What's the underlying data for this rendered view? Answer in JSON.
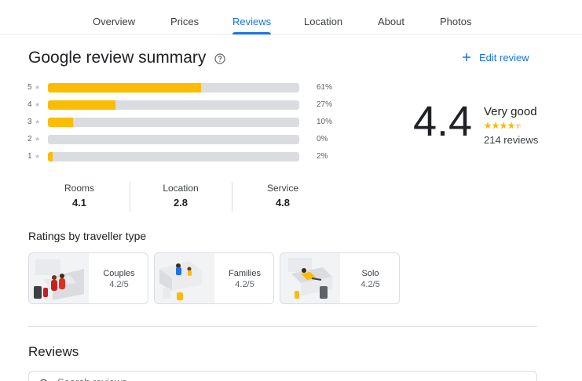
{
  "tabs": [
    {
      "label": "Overview"
    },
    {
      "label": "Prices"
    },
    {
      "label": "Reviews",
      "active": true
    },
    {
      "label": "Location"
    },
    {
      "label": "About"
    },
    {
      "label": "Photos"
    }
  ],
  "summary": {
    "title": "Google review summary",
    "edit_label": "Edit review",
    "histogram": [
      {
        "stars": "5",
        "percent_label": "61%",
        "fraction": 0.61
      },
      {
        "stars": "4",
        "percent_label": "27%",
        "fraction": 0.27
      },
      {
        "stars": "3",
        "percent_label": "10%",
        "fraction": 0.1
      },
      {
        "stars": "2",
        "percent_label": "0%",
        "fraction": 0.0
      },
      {
        "stars": "1",
        "percent_label": "2%",
        "fraction": 0.02
      }
    ],
    "overall": {
      "rating": "4.4",
      "verdict": "Very good",
      "review_count": "214 reviews",
      "stars_filled": 4.4
    },
    "categories": [
      {
        "label": "Rooms",
        "value": "4.1"
      },
      {
        "label": "Location",
        "value": "2.8"
      },
      {
        "label": "Service",
        "value": "4.8"
      }
    ]
  },
  "traveller": {
    "title": "Ratings by traveller type",
    "types": [
      {
        "name": "Couples",
        "value": "4.2/5"
      },
      {
        "name": "Families",
        "value": "4.2/5"
      },
      {
        "name": "Solo",
        "value": "4.2/5"
      }
    ]
  },
  "reviews": {
    "title": "Reviews",
    "search_placeholder": "Search reviews"
  },
  "colors": {
    "accent": "#1a73e8",
    "bar_fill": "#fbbc04",
    "bar_track": "#dadce0"
  }
}
